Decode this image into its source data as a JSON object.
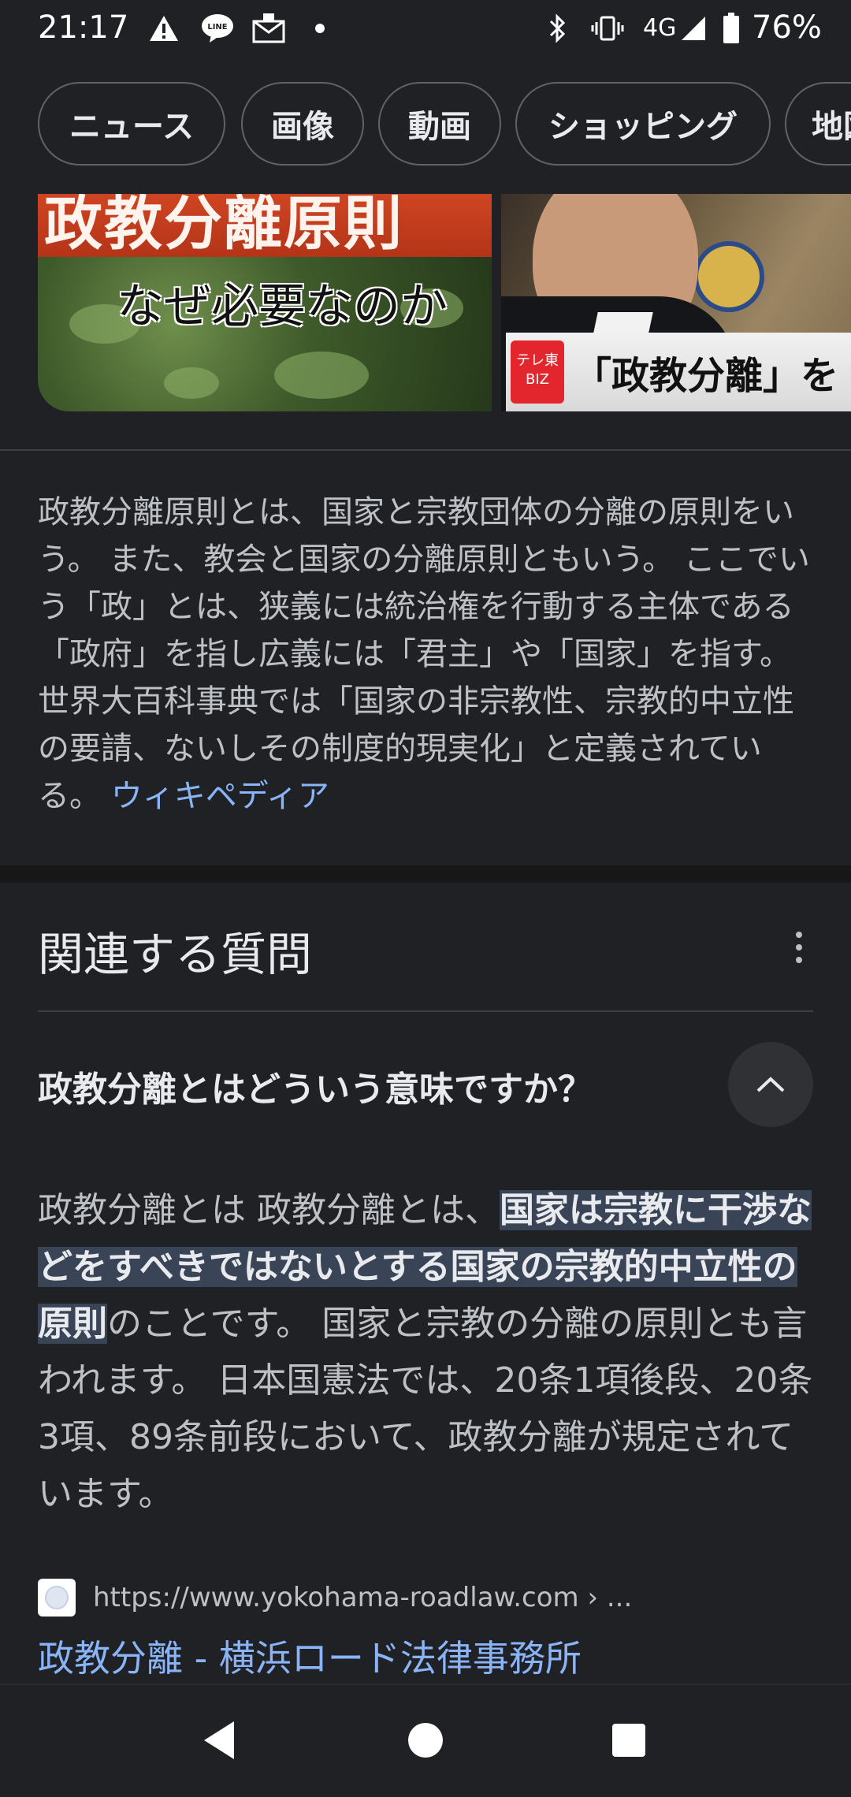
{
  "status_bar": {
    "time": "21:17",
    "network": "4G",
    "battery": "76%",
    "icons": [
      "warning-icon",
      "line-app-icon",
      "mail-icon",
      "dot-icon",
      "bluetooth-icon",
      "vibrate-icon",
      "signal-icon",
      "battery-icon"
    ]
  },
  "chips": [
    "ニュース",
    "画像",
    "動画",
    "ショッピング",
    "地図"
  ],
  "images": {
    "left": {
      "title_text": "政教分離原則",
      "subtitle_text": "なぜ必要なのか"
    },
    "right": {
      "badge_text": "テレ東 BIZ",
      "caption_text": "「政教分離」を"
    }
  },
  "description": {
    "text": "政教分離原則とは、国家と宗教団体の分離の原則をいう。 また、教会と国家の分離原則ともいう。 ここでいう「政」とは、狭義には統治権を行動する主体である「政府」を指し広義には「君主」や「国家」を指す。 世界大百科事典では「国家の非宗教性、宗教的中立性の要請、ないしその制度的現実化」と定義されている。 ",
    "source": "ウィキペディア"
  },
  "related_questions": {
    "title": "関連する質問",
    "question": "政教分離とはどういう意味ですか？",
    "answer_prefix": "政教分離とは 政教分離とは、",
    "answer_highlight": "国家は宗教に干渉などをすべきではないとする国家の宗教的中立性の原則",
    "answer_suffix": "のことです。 国家と宗教の分離の原則とも言われます。 日本国憲法では、20条1項後段、20条3項、89条前段において、政教分離が規定されています。",
    "site_url": "https://www.yokohama-roadlaw.com › ...",
    "site_title": "政教分離 - 横浜ロード法律事務所"
  },
  "colors": {
    "background": "#202124",
    "link": "#8ab4f8",
    "highlight": "#394457"
  }
}
